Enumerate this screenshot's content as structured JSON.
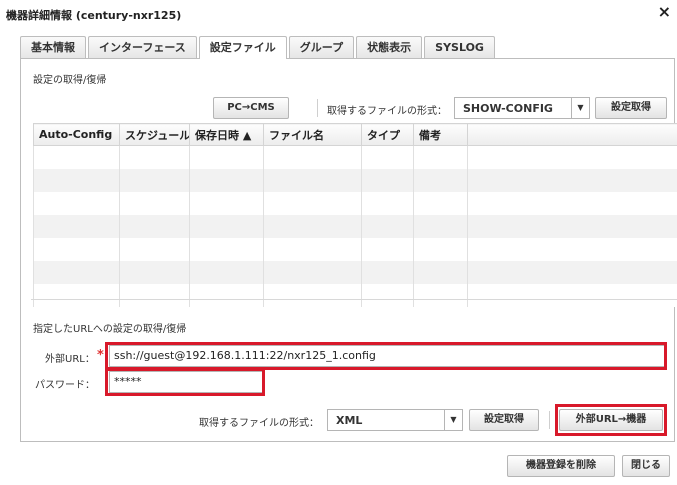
{
  "window": {
    "title": "機器詳細情報 (century-nxr125)",
    "close_glyph": "×"
  },
  "tabs": [
    {
      "label": "基本情報",
      "active": false
    },
    {
      "label": "インターフェース",
      "active": false
    },
    {
      "label": "設定ファイル",
      "active": true
    },
    {
      "label": "グループ",
      "active": false
    },
    {
      "label": "状態表示",
      "active": false
    },
    {
      "label": "SYSLOG",
      "active": false
    }
  ],
  "section1": {
    "label": "設定の取得/復帰",
    "pc_cms_button": "PC→CMS",
    "format_label": "取得するファイルの形式：",
    "format_value": "SHOW-CONFIG",
    "fetch_button": "設定取得"
  },
  "table": {
    "columns": [
      "Auto-Config",
      "スケジュール",
      "保存日時 ▲",
      "ファイル名",
      "タイプ",
      "備考",
      ""
    ],
    "rows": [
      [],
      [],
      [],
      [],
      [],
      [],
      []
    ]
  },
  "section2": {
    "label": "指定したURLへの設定の取得/復帰",
    "url_label": "外部URL：",
    "required_mark": "*",
    "url_value": "ssh://guest@192.168.1.111:22/nxr125_1.config",
    "password_label": "パスワード：",
    "password_value": "*****",
    "format_label": "取得するファイルの形式：",
    "format_value": "XML",
    "fetch_button": "設定取得",
    "push_button": "外部URL→機器"
  },
  "footer": {
    "delete_button": "機器登録を削除",
    "close_button": "閉じる"
  },
  "colors": {
    "highlight": "#d8192a",
    "required": "#e03030"
  }
}
